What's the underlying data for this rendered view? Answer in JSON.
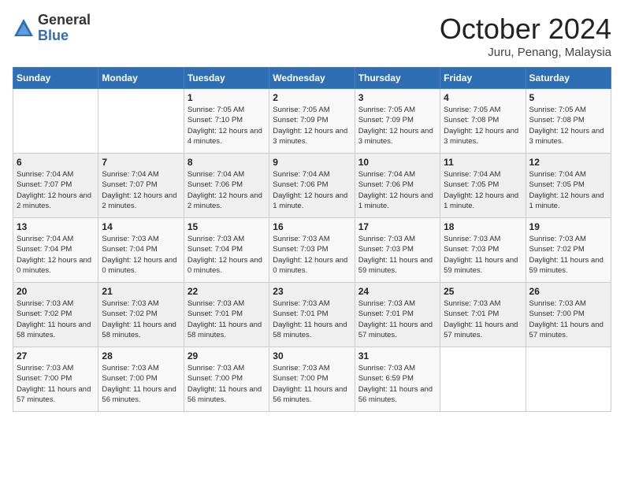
{
  "logo": {
    "general": "General",
    "blue": "Blue"
  },
  "title": "October 2024",
  "location": "Juru, Penang, Malaysia",
  "days_of_week": [
    "Sunday",
    "Monday",
    "Tuesday",
    "Wednesday",
    "Thursday",
    "Friday",
    "Saturday"
  ],
  "weeks": [
    [
      {
        "num": "",
        "info": ""
      },
      {
        "num": "",
        "info": ""
      },
      {
        "num": "1",
        "info": "Sunrise: 7:05 AM\nSunset: 7:10 PM\nDaylight: 12 hours and 4 minutes."
      },
      {
        "num": "2",
        "info": "Sunrise: 7:05 AM\nSunset: 7:09 PM\nDaylight: 12 hours and 3 minutes."
      },
      {
        "num": "3",
        "info": "Sunrise: 7:05 AM\nSunset: 7:09 PM\nDaylight: 12 hours and 3 minutes."
      },
      {
        "num": "4",
        "info": "Sunrise: 7:05 AM\nSunset: 7:08 PM\nDaylight: 12 hours and 3 minutes."
      },
      {
        "num": "5",
        "info": "Sunrise: 7:05 AM\nSunset: 7:08 PM\nDaylight: 12 hours and 3 minutes."
      }
    ],
    [
      {
        "num": "6",
        "info": "Sunrise: 7:04 AM\nSunset: 7:07 PM\nDaylight: 12 hours and 2 minutes."
      },
      {
        "num": "7",
        "info": "Sunrise: 7:04 AM\nSunset: 7:07 PM\nDaylight: 12 hours and 2 minutes."
      },
      {
        "num": "8",
        "info": "Sunrise: 7:04 AM\nSunset: 7:06 PM\nDaylight: 12 hours and 2 minutes."
      },
      {
        "num": "9",
        "info": "Sunrise: 7:04 AM\nSunset: 7:06 PM\nDaylight: 12 hours and 1 minute."
      },
      {
        "num": "10",
        "info": "Sunrise: 7:04 AM\nSunset: 7:06 PM\nDaylight: 12 hours and 1 minute."
      },
      {
        "num": "11",
        "info": "Sunrise: 7:04 AM\nSunset: 7:05 PM\nDaylight: 12 hours and 1 minute."
      },
      {
        "num": "12",
        "info": "Sunrise: 7:04 AM\nSunset: 7:05 PM\nDaylight: 12 hours and 1 minute."
      }
    ],
    [
      {
        "num": "13",
        "info": "Sunrise: 7:04 AM\nSunset: 7:04 PM\nDaylight: 12 hours and 0 minutes."
      },
      {
        "num": "14",
        "info": "Sunrise: 7:03 AM\nSunset: 7:04 PM\nDaylight: 12 hours and 0 minutes."
      },
      {
        "num": "15",
        "info": "Sunrise: 7:03 AM\nSunset: 7:04 PM\nDaylight: 12 hours and 0 minutes."
      },
      {
        "num": "16",
        "info": "Sunrise: 7:03 AM\nSunset: 7:03 PM\nDaylight: 12 hours and 0 minutes."
      },
      {
        "num": "17",
        "info": "Sunrise: 7:03 AM\nSunset: 7:03 PM\nDaylight: 11 hours and 59 minutes."
      },
      {
        "num": "18",
        "info": "Sunrise: 7:03 AM\nSunset: 7:03 PM\nDaylight: 11 hours and 59 minutes."
      },
      {
        "num": "19",
        "info": "Sunrise: 7:03 AM\nSunset: 7:02 PM\nDaylight: 11 hours and 59 minutes."
      }
    ],
    [
      {
        "num": "20",
        "info": "Sunrise: 7:03 AM\nSunset: 7:02 PM\nDaylight: 11 hours and 58 minutes."
      },
      {
        "num": "21",
        "info": "Sunrise: 7:03 AM\nSunset: 7:02 PM\nDaylight: 11 hours and 58 minutes."
      },
      {
        "num": "22",
        "info": "Sunrise: 7:03 AM\nSunset: 7:01 PM\nDaylight: 11 hours and 58 minutes."
      },
      {
        "num": "23",
        "info": "Sunrise: 7:03 AM\nSunset: 7:01 PM\nDaylight: 11 hours and 58 minutes."
      },
      {
        "num": "24",
        "info": "Sunrise: 7:03 AM\nSunset: 7:01 PM\nDaylight: 11 hours and 57 minutes."
      },
      {
        "num": "25",
        "info": "Sunrise: 7:03 AM\nSunset: 7:01 PM\nDaylight: 11 hours and 57 minutes."
      },
      {
        "num": "26",
        "info": "Sunrise: 7:03 AM\nSunset: 7:00 PM\nDaylight: 11 hours and 57 minutes."
      }
    ],
    [
      {
        "num": "27",
        "info": "Sunrise: 7:03 AM\nSunset: 7:00 PM\nDaylight: 11 hours and 57 minutes."
      },
      {
        "num": "28",
        "info": "Sunrise: 7:03 AM\nSunset: 7:00 PM\nDaylight: 11 hours and 56 minutes."
      },
      {
        "num": "29",
        "info": "Sunrise: 7:03 AM\nSunset: 7:00 PM\nDaylight: 11 hours and 56 minutes."
      },
      {
        "num": "30",
        "info": "Sunrise: 7:03 AM\nSunset: 7:00 PM\nDaylight: 11 hours and 56 minutes."
      },
      {
        "num": "31",
        "info": "Sunrise: 7:03 AM\nSunset: 6:59 PM\nDaylight: 11 hours and 56 minutes."
      },
      {
        "num": "",
        "info": ""
      },
      {
        "num": "",
        "info": ""
      }
    ]
  ]
}
